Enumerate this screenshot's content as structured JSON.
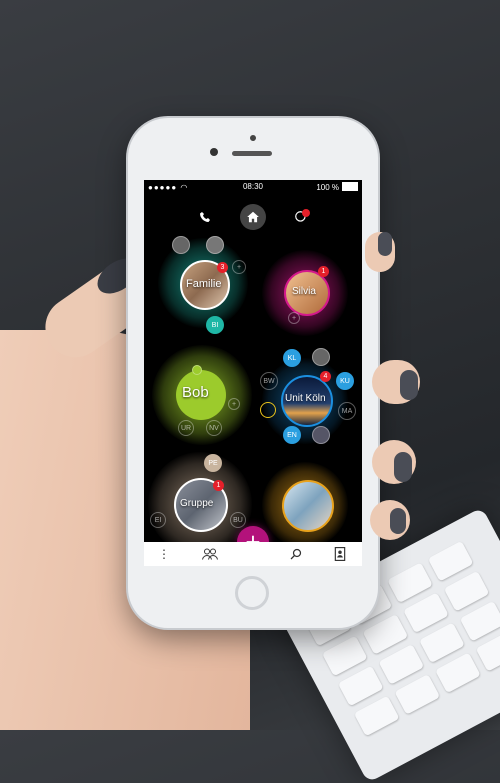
{
  "status_bar": {
    "time": "08:30",
    "battery": "100 %"
  },
  "top_nav": {
    "call_icon": "phone-icon",
    "home_icon": "home-icon",
    "notifications_icon": "chat-bubble-icon",
    "notifications_count": ""
  },
  "groups": {
    "familie": {
      "name": "Familie",
      "badge": "3",
      "member_initials": "BI"
    },
    "silvia": {
      "name": "Silvia",
      "badge": "1"
    },
    "bob": {
      "name": "Bob",
      "members": [
        "UR",
        "NV"
      ]
    },
    "unit_koeln": {
      "name": "Unit Köln",
      "badge": "4",
      "members": [
        "KL",
        "BW",
        "KU",
        "MA",
        "EN"
      ]
    },
    "gruppe": {
      "name": "Gruppe",
      "badge": "1",
      "members": [
        "PE",
        "EI",
        "BU"
      ]
    },
    "team": {
      "name": ""
    }
  },
  "bottom_nav": {
    "menu_icon": "more-vertical-icon",
    "contacts_icon": "people-icon",
    "add_icon": "plus-icon",
    "search_icon": "search-icon",
    "address_book_icon": "contact-book-icon"
  },
  "colors": {
    "familie": "#1fb7a6",
    "silvia": "#d4198c",
    "bob": "#9ccb2c",
    "unit_koeln": "#1b8fe0",
    "gruppe": "#b8a089",
    "team": "#e8a21c",
    "fab": "#b3127b"
  }
}
